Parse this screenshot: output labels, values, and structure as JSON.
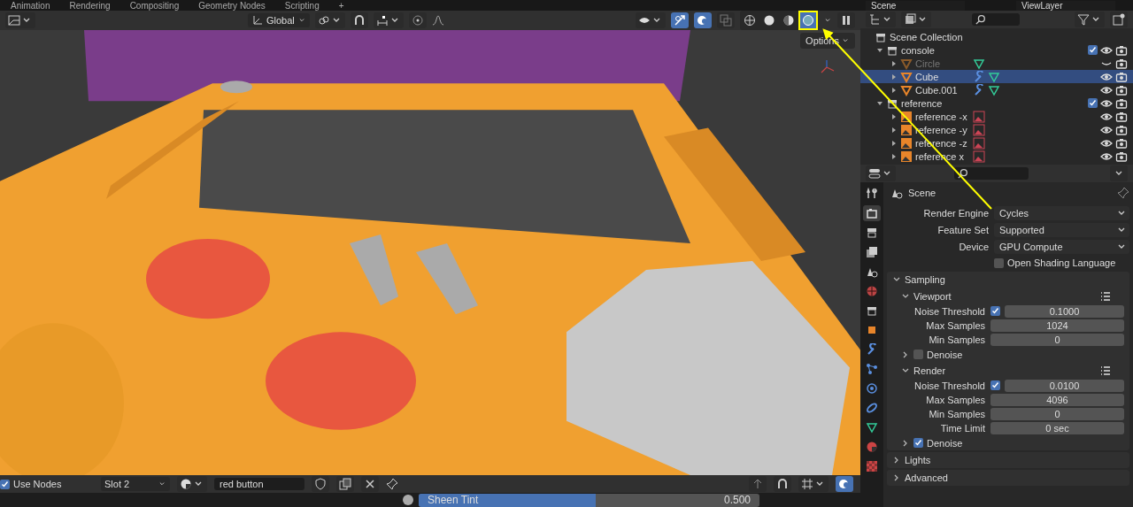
{
  "workspace_tabs": [
    {
      "label": "Animation",
      "selected": false
    },
    {
      "label": "Rendering",
      "selected": false
    },
    {
      "label": "Compositing",
      "selected": false
    },
    {
      "label": "Geometry Nodes",
      "selected": false
    },
    {
      "label": "Scripting",
      "selected": false
    }
  ],
  "add_tab": "+",
  "scene_field": {
    "value": "Scene"
  },
  "view_layer_field": {
    "value": "ViewLayer"
  },
  "viewport_header": {
    "orientation": "Global",
    "options": "Options",
    "shading_modes": [
      {
        "kind": "wireframe",
        "selected": false,
        "highlighted": false
      },
      {
        "kind": "solid",
        "selected": false,
        "highlighted": false
      },
      {
        "kind": "material",
        "selected": false,
        "highlighted": false
      },
      {
        "kind": "rendered",
        "selected": true,
        "highlighted": true
      }
    ]
  },
  "outliner": {
    "root": "Scene Collection",
    "collections": [
      {
        "name": "console",
        "checked": true,
        "expanded": true,
        "children": [
          {
            "name": "Circle",
            "kind": "mesh",
            "selected": false,
            "hidden": true,
            "modifier": false
          },
          {
            "name": "Cube",
            "kind": "mesh",
            "selected": true,
            "hidden": false,
            "modifier": true
          },
          {
            "name": "Cube.001",
            "kind": "mesh",
            "selected": false,
            "hidden": false,
            "modifier": true
          }
        ]
      },
      {
        "name": "reference",
        "checked": true,
        "expanded": true,
        "children": [
          {
            "name": "reference -x",
            "kind": "image",
            "selected": false,
            "hidden": false,
            "modifier": false
          },
          {
            "name": "reference -y",
            "kind": "image",
            "selected": false,
            "hidden": false,
            "modifier": false
          },
          {
            "name": "reference -z",
            "kind": "image",
            "selected": false,
            "hidden": false,
            "modifier": false
          },
          {
            "name": "reference x",
            "kind": "image",
            "selected": false,
            "hidden": false,
            "modifier": false
          }
        ]
      }
    ]
  },
  "properties": {
    "tabs": [
      {
        "kind": "tool",
        "selected": false
      },
      {
        "kind": "render",
        "selected": true
      },
      {
        "kind": "output",
        "selected": false
      },
      {
        "kind": "view-layer",
        "selected": false
      },
      {
        "kind": "scene",
        "selected": false
      },
      {
        "kind": "world",
        "selected": false
      },
      {
        "kind": "collection",
        "selected": false
      },
      {
        "kind": "object",
        "selected": false
      },
      {
        "kind": "modifier",
        "selected": false
      },
      {
        "kind": "particles",
        "selected": false
      },
      {
        "kind": "physics",
        "selected": false
      },
      {
        "kind": "constraints",
        "selected": false
      },
      {
        "kind": "data",
        "selected": false
      },
      {
        "kind": "material",
        "selected": false
      },
      {
        "kind": "texture",
        "selected": false
      }
    ],
    "context": "Scene",
    "fields": [
      {
        "label": "Render Engine",
        "value": "Cycles"
      },
      {
        "label": "Feature Set",
        "value": "Supported"
      },
      {
        "label": "Device",
        "value": "GPU Compute"
      }
    ],
    "osl": {
      "label": "Open Shading Language",
      "checked": false
    },
    "sampling": {
      "title": "Sampling",
      "expanded": true,
      "subpanels": [
        {
          "title": "Viewport",
          "expanded": true,
          "rows": [
            {
              "label": "Noise Threshold",
              "checked": true,
              "value": "0.1000"
            },
            {
              "label": "Max Samples",
              "value": "1024"
            },
            {
              "label": "Min Samples",
              "value": "0"
            }
          ]
        },
        {
          "title": "Denoise",
          "expanded": false,
          "checked": false
        },
        {
          "title": "Render",
          "expanded": true,
          "rows": [
            {
              "label": "Noise Threshold",
              "checked": true,
              "value": "0.0100"
            },
            {
              "label": "Max Samples",
              "value": "4096"
            },
            {
              "label": "Min Samples",
              "value": "0"
            },
            {
              "label": "Time Limit",
              "value": "0 sec"
            }
          ]
        },
        {
          "title": "Denoise",
          "expanded": false,
          "checked": true
        }
      ]
    },
    "panels": [
      {
        "title": "Lights",
        "expanded": false
      },
      {
        "title": "Advanced",
        "expanded": false
      }
    ]
  },
  "shader_header": {
    "use_nodes": {
      "label": "Use Nodes",
      "checked": true
    },
    "slot": "Slot 2",
    "material": "red button"
  },
  "sheen_tint": {
    "label": "Sheen Tint",
    "value": "0.500",
    "level": 0.52
  }
}
